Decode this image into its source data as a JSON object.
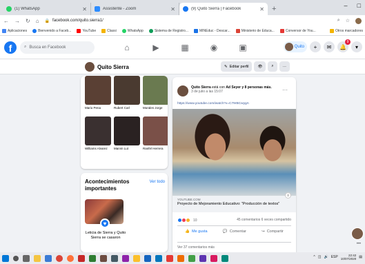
{
  "browser": {
    "tabs": [
      {
        "title": "(1) WhatsApp",
        "favicon_color": "#25d366"
      },
      {
        "title": "Assistente - Zoom",
        "favicon_color": "#2d8cff"
      },
      {
        "title": "(9) Quito Sierra | Facebook",
        "favicon_color": "#1877f2"
      }
    ],
    "new_tab": "+",
    "url": "facebook.com/quito.sierra1/",
    "bookmarks": [
      {
        "label": "Aplicaciones",
        "color": "#4285f4"
      },
      {
        "label": "Bienvenido a Faceb...",
        "color": "#1877f2"
      },
      {
        "label": "YouTube",
        "color": "#ff0000"
      },
      {
        "label": "Classi",
        "color": "#f4b400"
      },
      {
        "label": "WhatsApp",
        "color": "#25d366"
      },
      {
        "label": "Sistema de Registro...",
        "color": "#0f9d58"
      },
      {
        "label": "MINEduc - Descar...",
        "color": "#1a73e8"
      },
      {
        "label": "Ministerio de Educa...",
        "color": "#db4437"
      },
      {
        "label": "Conversor de You...",
        "color": "#e53935"
      }
    ],
    "other_bookmarks": "Otros marcadores"
  },
  "facebook": {
    "search_placeholder": "Busca en Facebook",
    "user_short": "Quito",
    "notif_count": "9"
  },
  "profile": {
    "name": "Quito Sierra",
    "edit_label": "Editar perfil"
  },
  "friends": [
    {
      "name": "Mario Pena",
      "color": "#5a4034"
    },
    {
      "name": "Rubert Carl",
      "color": "#4a3a30"
    },
    {
      "name": "Morales Jorge",
      "color": "#6a7a50"
    },
    {
      "name": "Williams Alvarez",
      "color": "#3a3030"
    },
    {
      "name": "Marvin Lut",
      "color": "#2a2222"
    },
    {
      "name": "Ranfel Herrera",
      "color": "#7a5048"
    }
  ],
  "events": {
    "title": "Acontecimientos importantes",
    "see_all": "Ver todo",
    "event_text": "Leticia de Sierra y Quito Sierra se casaron"
  },
  "post": {
    "author": "Quito Sierra",
    "with_text": "está con",
    "tagged": "Ad Seyer y 8 personas más.",
    "date": "3 de julio a las 15:07",
    "link": "https://www.youtube.com/watch?v=C79rBCwygA",
    "domain": "YOUTUBE.COM",
    "title": "Proyecto de Mejoramiento Educativo: \"Producción de textos\"",
    "reaction_count": "10",
    "comments_shares": "45 comentarios 6 veces compartido",
    "like": "Me gusta",
    "comment": "Comentar",
    "share": "Compartir",
    "more_comments": "Ver 37 comentarios más"
  },
  "taskbar": {
    "lang": "ESP",
    "time": "22:42",
    "date": "10/07/2020"
  }
}
